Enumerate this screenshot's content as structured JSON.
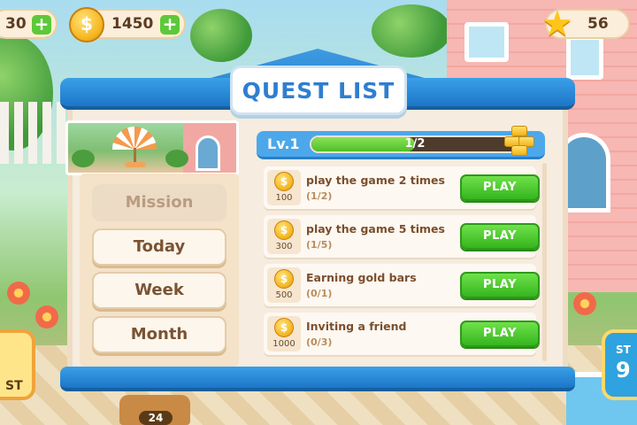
{
  "hud": {
    "left_partial_value": "30",
    "coins_value": "1450",
    "stars_value": "56",
    "plus_label": "+",
    "coin_symbol": "$",
    "star_symbol": "★"
  },
  "panel": {
    "title": "QUEST LIST"
  },
  "tabs": [
    {
      "label": "Mission",
      "active": true
    },
    {
      "label": "Today",
      "active": false
    },
    {
      "label": "Week",
      "active": false
    },
    {
      "label": "Month",
      "active": false
    }
  ],
  "level": {
    "label": "Lv.1",
    "progress_text": "1/2",
    "progress_fraction": 0.5
  },
  "quests": [
    {
      "title": "play the game 2 times",
      "progress": "(1/2)",
      "reward": "100",
      "button": "PLAY"
    },
    {
      "title": "play the game 5 times",
      "progress": "(1/5)",
      "reward": "300",
      "button": "PLAY"
    },
    {
      "title": "Earning gold bars",
      "progress": "(0/1)",
      "reward": "500",
      "button": "PLAY"
    },
    {
      "title": "Inviting a friend",
      "progress": "(0/3)",
      "reward": "1000",
      "button": "PLAY"
    }
  ],
  "background": {
    "left_widget_text": "ST",
    "right_widget_text_1": "ST",
    "right_widget_text_2": "9",
    "basket_counter": "24"
  },
  "colors": {
    "panel_blue": "#2e7ed0",
    "play_green": "#35b51e",
    "panel_bg": "#f6ecdf",
    "text_brown": "#7a4f2e"
  }
}
